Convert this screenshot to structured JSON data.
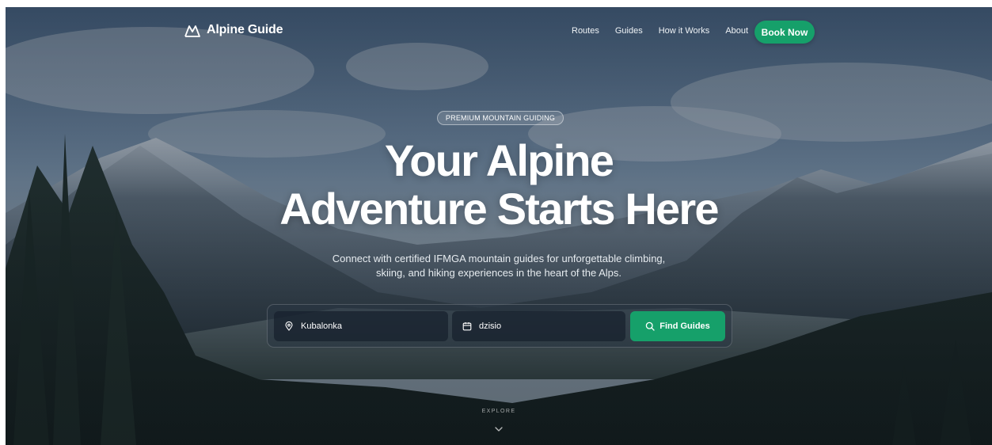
{
  "brand": {
    "name": "Alpine Guide",
    "icon": "mountain-icon"
  },
  "nav": {
    "links": [
      {
        "label": "Routes"
      },
      {
        "label": "Guides"
      },
      {
        "label": "How it Works"
      },
      {
        "label": "About"
      }
    ],
    "cta_label": "Book Now"
  },
  "hero": {
    "badge": "PREMIUM MOUNTAIN GUIDING",
    "headline_line1": "Your Alpine",
    "headline_line2": "Adventure Starts Here",
    "subtitle_line1": "Connect with certified IFMGA mountain guides for unforgettable climbing,",
    "subtitle_line2": "skiing, and hiking experiences in the heart of the Alps."
  },
  "search": {
    "location": {
      "icon": "map-pin-icon",
      "value": "Kubalonka"
    },
    "date": {
      "icon": "calendar-icon",
      "value": "dzisio"
    },
    "submit": {
      "icon": "search-icon",
      "label": "Find Guides"
    }
  },
  "explore": {
    "label": "EXPLORE",
    "icon": "chevron-down-icon"
  },
  "colors": {
    "accent": "#16a06a",
    "text": "#ffffff"
  }
}
